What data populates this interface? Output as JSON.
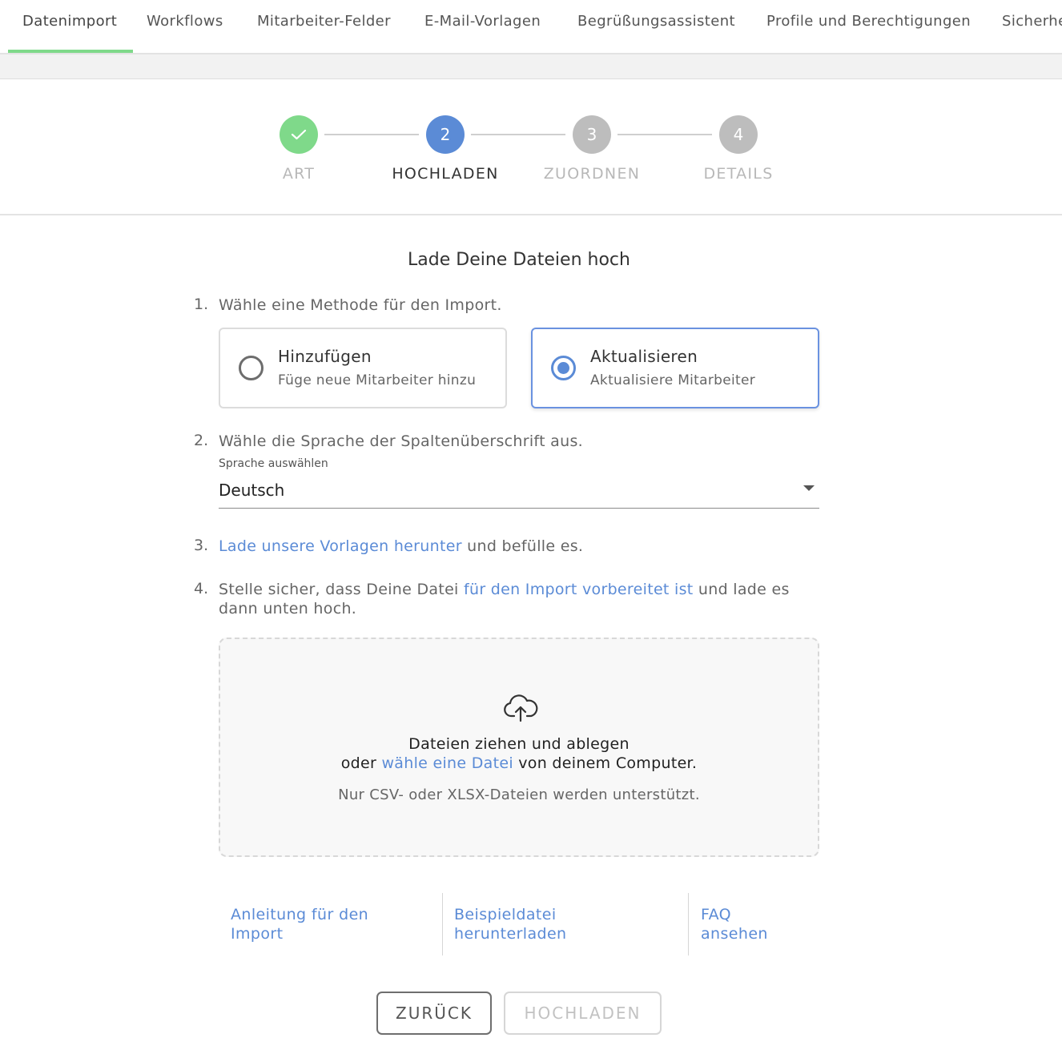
{
  "tabs": [
    {
      "label": "Datenimport",
      "active": true
    },
    {
      "label": "Workflows",
      "active": false
    },
    {
      "label": "Mitarbeiter-Felder",
      "active": false
    },
    {
      "label": "E-Mail-Vorlagen",
      "active": false
    },
    {
      "label": "Begrüßungsassistent",
      "active": false
    },
    {
      "label": "Profile und Berechtigungen",
      "active": false
    },
    {
      "label": "Sicherhe",
      "active": false
    }
  ],
  "stepper": {
    "steps": [
      {
        "number": "",
        "label": "ART",
        "status": "done",
        "icon": "check-icon"
      },
      {
        "number": "2",
        "label": "HOCHLADEN",
        "status": "current"
      },
      {
        "number": "3",
        "label": "ZUORDNEN",
        "status": "pending"
      },
      {
        "number": "4",
        "label": "DETAILS",
        "status": "pending"
      }
    ],
    "colors": {
      "done": "#7fd98a",
      "current": "#5b8bd6",
      "pending": "#bdbdbd"
    }
  },
  "main": {
    "title": "Lade Deine Dateien hoch",
    "step1": {
      "number": "1.",
      "text": "Wähle eine Methode für den Import.",
      "options": [
        {
          "title": "Hinzufügen",
          "subtitle": "Füge neue Mitarbeiter hinzu",
          "selected": false
        },
        {
          "title": "Aktualisieren",
          "subtitle": "Aktualisiere Mitarbeiter",
          "selected": true
        }
      ]
    },
    "step2": {
      "number": "2.",
      "text": "Wähle die Sprache der Spaltenüberschrift aus.",
      "select_label": "Sprache auswählen",
      "select_value": "Deutsch"
    },
    "step3": {
      "number": "3.",
      "link": "Lade unsere Vorlagen herunter",
      "text_after": " und befülle es."
    },
    "step4": {
      "number": "4.",
      "text_before": "Stelle sicher, dass Deine Datei ",
      "link": "für den Import vorbereitet ist",
      "text_after": " und lade es",
      "line2": "dann unten hoch."
    },
    "dropzone": {
      "icon": "cloud-upload-icon",
      "line1": "Dateien ziehen und ablegen",
      "line2_before": "oder ",
      "line2_link": "wähle eine Datei",
      "line2_after": " von deinem Computer.",
      "note": "Nur CSV- oder XLSX-Dateien werden unterstützt."
    }
  },
  "help_links": [
    {
      "line1": "Anleitung für den",
      "line2": "Import"
    },
    {
      "line1": "Beispieldatei",
      "line2": "herunterladen"
    },
    {
      "line1": "FAQ",
      "line2": "ansehen"
    }
  ],
  "buttons": {
    "back": "ZURÜCK",
    "upload": "HOCHLADEN"
  },
  "colors": {
    "accent": "#5b8bd6",
    "tab_indicator": "#7fd98a"
  }
}
